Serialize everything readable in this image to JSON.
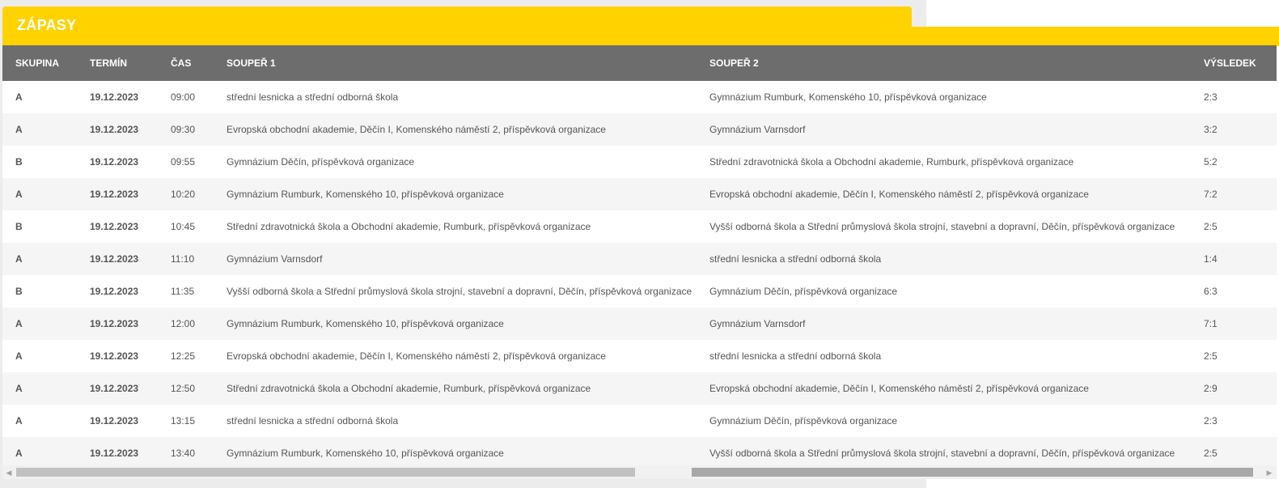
{
  "header": {
    "title": "ZÁPASY"
  },
  "table": {
    "columns": [
      "SKUPINA",
      "TERMÍN",
      "ČAS",
      "SOUPEŘ 1",
      "SOUPEŘ 2",
      "VÝSLEDEK"
    ],
    "rows": [
      [
        "A",
        "19.12.2023",
        "09:00",
        "střední lesnicka a střední odborná škola",
        "Gymnázium Rumburk, Komenského 10, příspěvková organizace",
        "2:3"
      ],
      [
        "A",
        "19.12.2023",
        "09:30",
        "Evropská obchodní akademie, Děčín I, Komenského náměstí 2, příspěvková organizace",
        "Gymnázium Varnsdorf",
        "3:2"
      ],
      [
        "B",
        "19.12.2023",
        "09:55",
        "Gymnázium Děčín, příspěvková organizace",
        "Střední zdravotnická škola a Obchodní akademie, Rumburk, příspěvková organizace",
        "5:2"
      ],
      [
        "A",
        "19.12.2023",
        "10:20",
        "Gymnázium Rumburk, Komenského 10, příspěvková organizace",
        "Evropská obchodní akademie, Děčín I, Komenského náměstí 2, příspěvková organizace",
        "7:2"
      ],
      [
        "B",
        "19.12.2023",
        "10:45",
        "Střední zdravotnická škola a Obchodní akademie, Rumburk, příspěvková organizace",
        "Vyšší odborná škola a Střední průmyslová škola strojní, stavební a dopravní, Děčín, příspěvková organizace",
        "2:5"
      ],
      [
        "A",
        "19.12.2023",
        "11:10",
        "Gymnázium Varnsdorf",
        "střední lesnicka a střední odborná škola",
        "1:4"
      ],
      [
        "B",
        "19.12.2023",
        "11:35",
        "Vyšší odborná škola a Střední průmyslová škola strojní, stavební a dopravní, Děčín, příspěvková organizace",
        "Gymnázium Děčín, příspěvková organizace",
        "6:3"
      ],
      [
        "A",
        "19.12.2023",
        "12:00",
        "Gymnázium Rumburk, Komenského 10, příspěvková organizace",
        "Gymnázium Varnsdorf",
        "7:1"
      ],
      [
        "A",
        "19.12.2023",
        "12:25",
        "Evropská obchodní akademie, Děčín I, Komenského náměstí 2, příspěvková organizace",
        "střední lesnicka a střední odborná škola",
        "2:5"
      ],
      [
        "A",
        "19.12.2023",
        "12:50",
        "Střední zdravotnická škola a Obchodní akademie, Rumburk, příspěvková organizace",
        "Evropská obchodní akademie, Děčín I, Komenského náměstí 2, příspěvková organizace",
        "2:9"
      ],
      [
        "A",
        "19.12.2023",
        "13:15",
        "střední lesnicka a střední odborná škola",
        "Gymnázium Děčín, příspěvková organizace",
        "2:3"
      ],
      [
        "A",
        "19.12.2023",
        "13:40",
        "Gymnázium Rumburk, Komenského 10, příspěvková organizace",
        "Vyšší odborná škola a Střední průmyslová škola strojní, stavební a dopravní, Děčín, příspěvková organizace",
        "2:5"
      ]
    ]
  },
  "scrollbar": {
    "left_arrow": "◀",
    "right_arrow": "▶"
  },
  "colors": {
    "accent": "#ffd200",
    "header_bg": "#6d6d6d",
    "row_alt": "#f5f5f5"
  }
}
